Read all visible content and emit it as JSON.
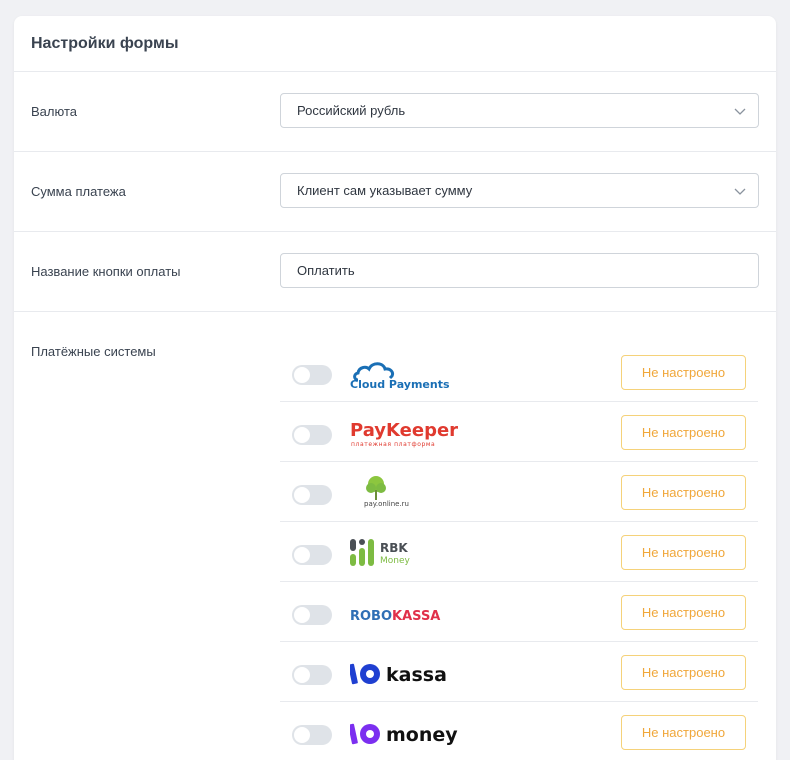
{
  "title": "Настройки формы",
  "currency": {
    "label": "Валюта",
    "value": "Российский рубль"
  },
  "amount": {
    "label": "Сумма платежа",
    "value": "Клиент сам указывает сумму"
  },
  "button_name": {
    "label": "Название кнопки оплаты",
    "value": "Оплатить"
  },
  "payment_systems": {
    "label": "Платёжные системы",
    "items": [
      {
        "logo": "cloudpayments-logo",
        "logo_text": "Cloud Payments",
        "enabled": false,
        "status": "Не настроено"
      },
      {
        "logo": "paykeeper-logo",
        "logo_text": "PayKeeper",
        "logo_sub": "платежная платформа",
        "enabled": false,
        "status": "Не настроено"
      },
      {
        "logo": "payonline-logo",
        "logo_text": "pay.online.ru",
        "enabled": false,
        "status": "Не настроено"
      },
      {
        "logo": "rbkmoney-logo",
        "logo_text": "RBK",
        "logo_sub": "Money",
        "enabled": false,
        "status": "Не настроено"
      },
      {
        "logo": "robokassa-logo",
        "logo_text": "ROBO",
        "logo_text2": "KASSA",
        "enabled": false,
        "status": "Не настроено"
      },
      {
        "logo": "yookassa-logo",
        "logo_text": "kassa",
        "enabled": false,
        "status": "Не настроено"
      },
      {
        "logo": "yoomoney-logo",
        "logo_text": "money",
        "enabled": false,
        "status": "Не настроено"
      }
    ]
  },
  "colors": {
    "accent_warning": "#f0a73a",
    "cloudpayments": "#1a6fb5",
    "paykeeper": "#e03a2f",
    "rbk_green": "#7dbb42",
    "robokassa_blue": "#2f6fb5",
    "robokassa_red": "#e0304a",
    "yoo_blue": "#1f3fd1",
    "yoo_purple": "#7b2ff0"
  }
}
